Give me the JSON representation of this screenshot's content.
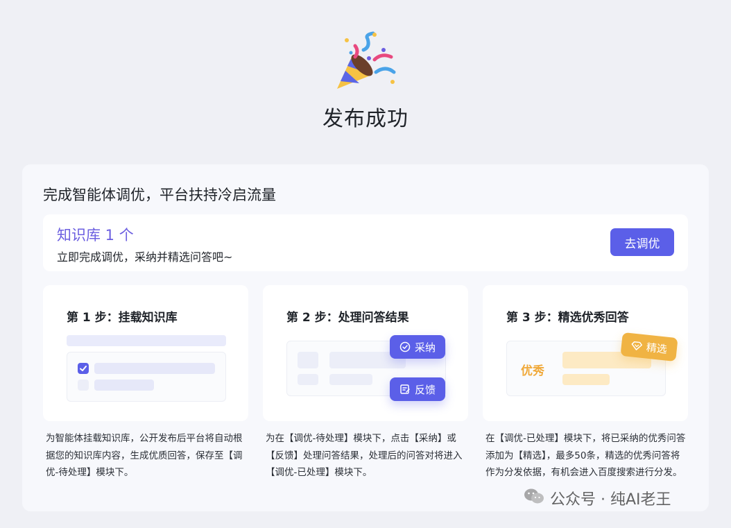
{
  "header": {
    "title": "发布成功"
  },
  "panel": {
    "title": "完成智能体调优，平台扶持冷启流量",
    "knowledge": {
      "title": "知识库 1 个",
      "subtitle": "立即完成调优，采纳并精选问答吧~",
      "button_label": "去调优"
    },
    "steps": [
      {
        "title": "第 1 步：挂载知识库",
        "description": "为智能体挂载知识库，公开发布后平台将自动根据您的知识库内容，生成优质回答，保存至【调优-待处理】模块下。"
      },
      {
        "title": "第 2 步：处理问答结果",
        "description": "为在【调优-待处理】模块下，点击【采纳】或【反馈】处理问答结果，处理后的问答对将进入【调优-已处理】模块下。",
        "adopt_label": "采纳",
        "feedback_label": "反馈"
      },
      {
        "title": "第 3 步：精选优秀回答",
        "description": "在【调优-已处理】模块下，将已采纳的优秀问答添加为【精选】，最多50条，精选的优秀问答将作为分发依据，有机会进入百度搜索进行分发。",
        "featured_label": "精选",
        "excellent_label": "优秀"
      }
    ]
  },
  "watermark": {
    "text": "公众号 · 纯AI老王"
  },
  "colors": {
    "accent": "#5b5fe8",
    "title_purple": "#6b5ee0",
    "gold": "#f0b343",
    "background": "#eff0f5"
  }
}
